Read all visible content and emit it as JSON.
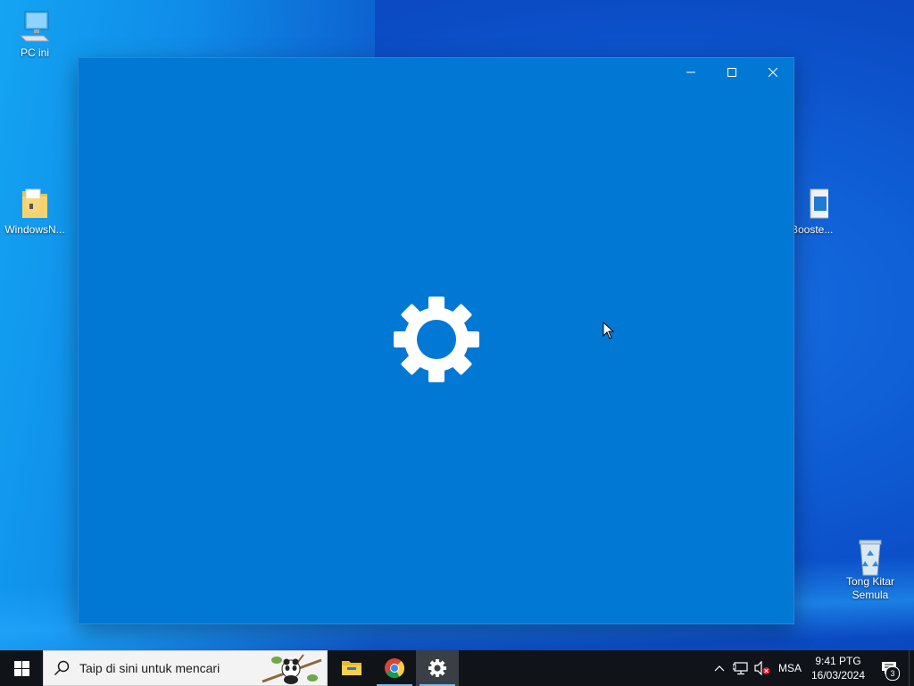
{
  "desktop": {
    "icons": [
      {
        "label": "PC ini",
        "icon": "computer-icon"
      },
      {
        "label": "WindowsN...",
        "icon": "folder-icon"
      },
      {
        "label": "Booste...",
        "icon": "app-file-icon"
      },
      {
        "label": "Tong Kitar Semula",
        "icon": "recycle-bin-icon"
      }
    ]
  },
  "window": {
    "app": "Settings",
    "splash_icon": "gear-icon",
    "background_color": "#0178d4",
    "controls": {
      "minimize": "minimize-icon",
      "maximize": "maximize-icon",
      "close": "close-icon"
    }
  },
  "taskbar": {
    "search_placeholder": "Taip di sini untuk mencari",
    "apps": [
      {
        "name": "File Explorer",
        "icon": "folder-icon",
        "active": false
      },
      {
        "name": "Google Chrome",
        "icon": "chrome-icon",
        "active": false
      },
      {
        "name": "Settings",
        "icon": "gear-icon",
        "active": true
      }
    ],
    "tray": {
      "language": "MSA",
      "time": "9:41 PTG",
      "date": "16/03/2024",
      "notification_count": "3"
    }
  }
}
